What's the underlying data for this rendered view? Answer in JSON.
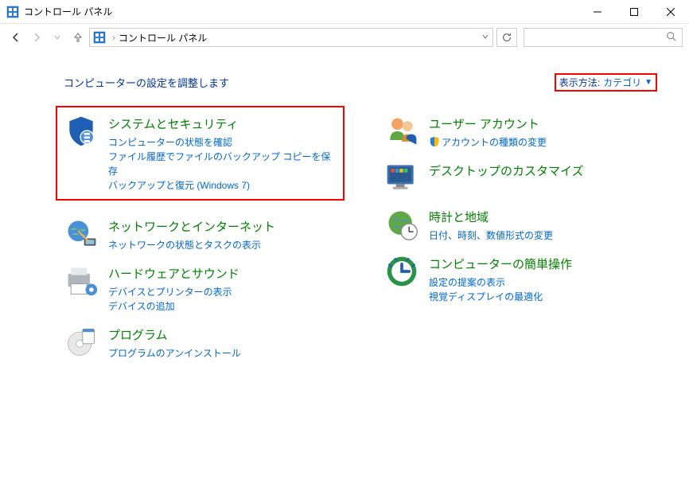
{
  "window": {
    "title": "コントロール パネル"
  },
  "address": {
    "path": "コントロール パネル"
  },
  "content": {
    "heading": "コンピューターの設定を調整します",
    "viewBy": {
      "label": "表示方法:",
      "value": "カテゴリ"
    },
    "left": [
      {
        "title": "システムとセキュリティ",
        "links": [
          "コンピューターの状態を確認",
          "ファイル履歴でファイルのバックアップ コピーを保存",
          "バックアップと復元 (Windows 7)"
        ],
        "highlighted": true
      },
      {
        "title": "ネットワークとインターネット",
        "links": [
          "ネットワークの状態とタスクの表示"
        ]
      },
      {
        "title": "ハードウェアとサウンド",
        "links": [
          "デバイスとプリンターの表示",
          "デバイスの追加"
        ]
      },
      {
        "title": "プログラム",
        "links": [
          "プログラムのアンインストール"
        ]
      }
    ],
    "right": [
      {
        "title": "ユーザー アカウント",
        "links": [
          "アカウントの種類の変更"
        ]
      },
      {
        "title": "デスクトップのカスタマイズ",
        "links": []
      },
      {
        "title": "時計と地域",
        "links": [
          "日付、時刻、数値形式の変更"
        ]
      },
      {
        "title": "コンピューターの簡単操作",
        "links": [
          "設定の提案の表示",
          "視覚ディスプレイの最適化"
        ]
      }
    ]
  }
}
